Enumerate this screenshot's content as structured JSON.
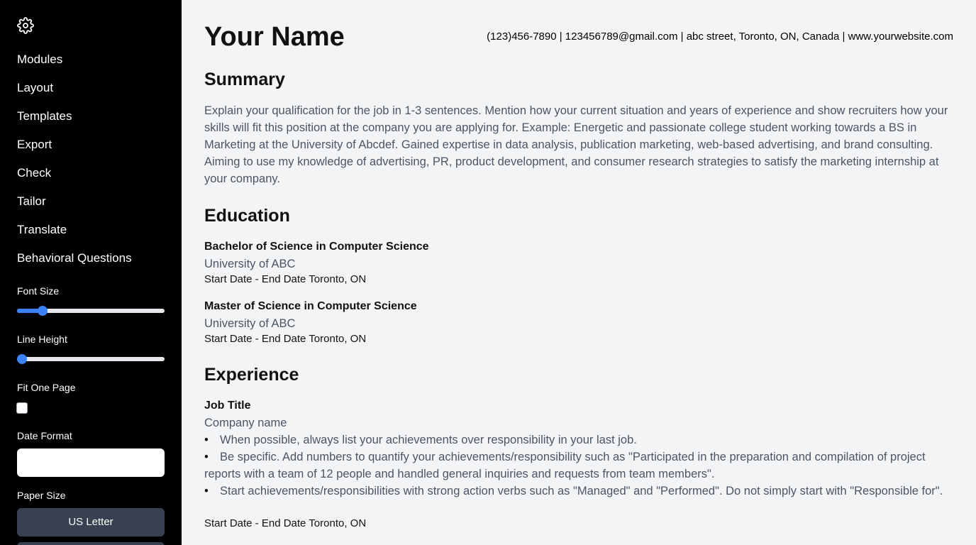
{
  "sidebar": {
    "settings_icon": "gear-icon",
    "nav": [
      {
        "label": "Modules"
      },
      {
        "label": "Layout"
      },
      {
        "label": "Templates"
      },
      {
        "label": "Export"
      },
      {
        "label": "Check"
      },
      {
        "label": "Tailor"
      },
      {
        "label": "Translate"
      },
      {
        "label": "Behavioral Questions"
      }
    ],
    "font_size": {
      "label": "Font Size",
      "value_fraction": 0.15
    },
    "line_height": {
      "label": "Line Height",
      "value_fraction": 0.0
    },
    "fit_one_page": {
      "label": "Fit One Page",
      "checked": false
    },
    "date_format": {
      "label": "Date Format",
      "value": ""
    },
    "paper_size": {
      "label": "Paper Size",
      "selected": "US Letter"
    }
  },
  "resume": {
    "name": "Your Name",
    "contact": "(123)456-7890 | 123456789@gmail.com | abc street, Toronto, ON, Canada | www.yourwebsite.com",
    "summary": {
      "title": "Summary",
      "text": "Explain your qualification for the job in 1-3 sentences. Mention how your current situation and years of experience and show recruiters how your skills will fit this position at the company you are applying for. Example: Energetic and passionate college student working towards a BS in Marketing at the University of Abcdef. Gained expertise in data analysis, publication marketing, web-based advertising, and brand consulting. Aiming to use my knowledge of advertising, PR, product development, and consumer research strategies to satisfy the marketing internship at your company."
    },
    "education": {
      "title": "Education",
      "entries": [
        {
          "degree": "Bachelor of Science in Computer Science",
          "school": "University of ABC",
          "dates": "Start Date - End Date Toronto, ON"
        },
        {
          "degree": "Master of Science in Computer Science",
          "school": "University of ABC",
          "dates": "Start Date - End Date Toronto, ON"
        }
      ]
    },
    "experience": {
      "title": "Experience",
      "entries": [
        {
          "job_title": "Job Title",
          "company": "Company name",
          "bullets": [
            "When possible, always list your achievements over responsibility in your last job.",
            "Be specific. Add numbers to quantify your achievements/responsibility such as \"Participated in the preparation and compilation of project reports with a team of 12 people and handled general inquiries and requests from team members\".",
            "Start achievements/responsibilities with strong action verbs such as \"Managed\" and \"Performed\". Do not simply start with \"Responsible for\"."
          ],
          "dates": "Start Date - End Date Toronto, ON"
        }
      ]
    }
  },
  "colors": {
    "sidebar_bg": "#000000",
    "page_bg": "#f3f4f6",
    "accent": "#3b82f6",
    "button_bg": "#374151",
    "body_text": "#4b5563"
  }
}
